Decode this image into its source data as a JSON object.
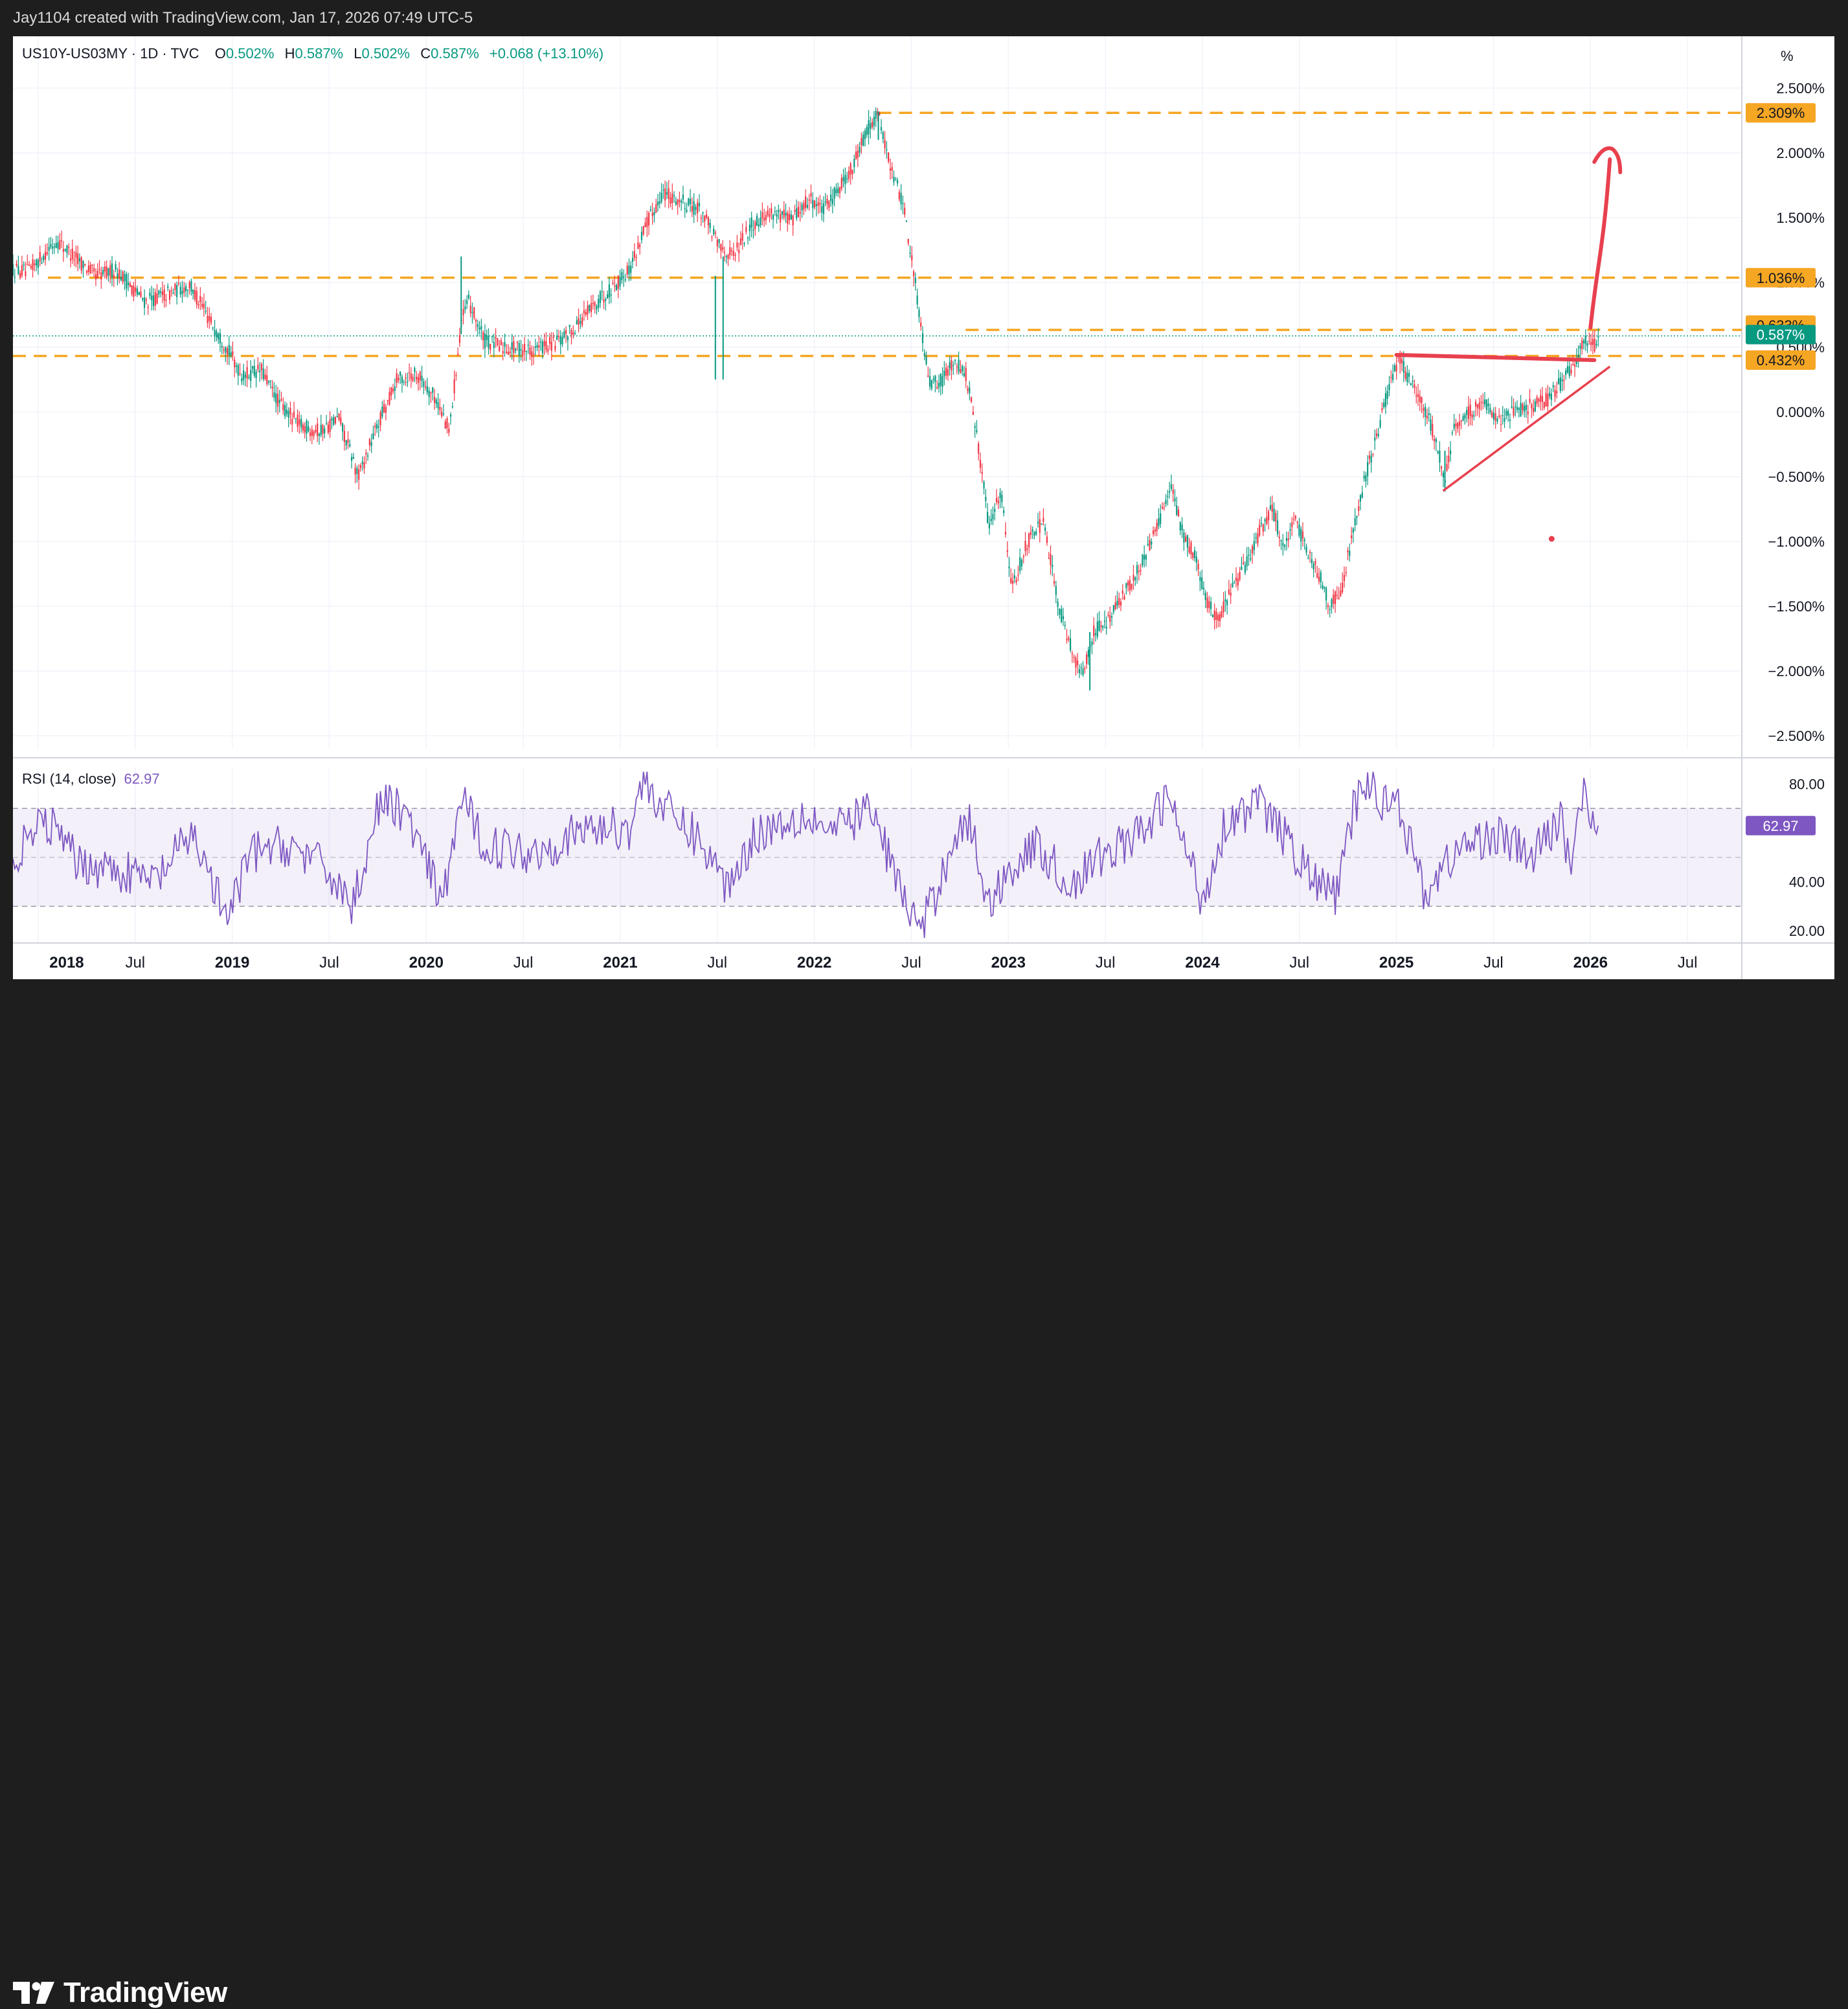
{
  "credit": "Jay1104 created with TradingView.com, Jan 17, 2026 07:49 UTC-5",
  "legend": {
    "symbol": "US10Y-US03MY · 1D · TVC",
    "o_label": "O",
    "o_value": "0.502%",
    "h_label": "H",
    "h_value": "0.587%",
    "l_label": "L",
    "l_value": "0.502%",
    "c_label": "C",
    "c_value": "0.587%",
    "change": "+0.068 (+13.10%)"
  },
  "unit_label": "%",
  "rsi_legend": {
    "label": "RSI (14, close)",
    "value": "62.97"
  },
  "brand": "TradingView",
  "colors": {
    "up": "#089981",
    "down": "#f23645",
    "level": "#f5a623",
    "rsi": "#7e57c2",
    "annotation": "#e8404e",
    "grid": "#f0f3fa"
  },
  "chart_data": [
    {
      "type": "candlestick",
      "symbol": "US10Y-US03MY",
      "unit": "%",
      "ylim": [
        -2.6,
        2.6
      ],
      "y_ticks": [
        "2.500%",
        "2.000%",
        "1.500%",
        "1.000%",
        "0.500%",
        "0.000%",
        "−0.500%",
        "−1.000%",
        "−1.500%",
        "−2.000%",
        "−2.500%"
      ],
      "y_tick_values": [
        2.5,
        2.0,
        1.5,
        1.0,
        0.5,
        0.0,
        -0.5,
        -1.0,
        -1.5,
        -2.0,
        -2.5
      ],
      "x_ticks": [
        "2018",
        "Jul",
        "2019",
        "Jul",
        "2020",
        "Jul",
        "2021",
        "Jul",
        "2022",
        "Jul",
        "2023",
        "Jul",
        "2024",
        "Jul",
        "2025",
        "Jul",
        "2026",
        "Jul"
      ],
      "x_tick_dates": [
        2018.0,
        2018.5,
        2019.0,
        2019.5,
        2020.0,
        2020.5,
        2021.0,
        2021.5,
        2022.0,
        2022.5,
        2023.0,
        2023.5,
        2024.0,
        2024.5,
        2025.0,
        2025.5,
        2026.0,
        2026.5
      ],
      "x_range": [
        2017.87,
        2026.78
      ],
      "price_path": [
        [
          2017.87,
          1.1
        ],
        [
          2017.95,
          1.08
        ],
        [
          2018.05,
          1.25
        ],
        [
          2018.1,
          1.32
        ],
        [
          2018.2,
          1.18
        ],
        [
          2018.3,
          1.05
        ],
        [
          2018.4,
          1.1
        ],
        [
          2018.55,
          0.85
        ],
        [
          2018.65,
          0.9
        ],
        [
          2018.78,
          0.98
        ],
        [
          2018.88,
          0.72
        ],
        [
          2018.97,
          0.5
        ],
        [
          2019.05,
          0.28
        ],
        [
          2019.15,
          0.32
        ],
        [
          2019.25,
          0.05
        ],
        [
          2019.35,
          -0.1
        ],
        [
          2019.45,
          -0.15
        ],
        [
          2019.55,
          -0.05
        ],
        [
          2019.65,
          -0.5
        ],
        [
          2019.75,
          -0.1
        ],
        [
          2019.85,
          0.25
        ],
        [
          2019.95,
          0.3
        ],
        [
          2020.05,
          0.1
        ],
        [
          2020.12,
          -0.15
        ],
        [
          2020.18,
          0.7
        ],
        [
          2020.22,
          0.85
        ],
        [
          2020.3,
          0.55
        ],
        [
          2020.4,
          0.5
        ],
        [
          2020.55,
          0.48
        ],
        [
          2020.7,
          0.55
        ],
        [
          2020.85,
          0.8
        ],
        [
          2020.95,
          0.95
        ],
        [
          2021.05,
          1.1
        ],
        [
          2021.12,
          1.4
        ],
        [
          2021.22,
          1.7
        ],
        [
          2021.32,
          1.62
        ],
        [
          2021.42,
          1.55
        ],
        [
          2021.5,
          1.3
        ],
        [
          2021.58,
          1.2
        ],
        [
          2021.68,
          1.45
        ],
        [
          2021.78,
          1.55
        ],
        [
          2021.88,
          1.48
        ],
        [
          2021.98,
          1.65
        ],
        [
          2022.05,
          1.55
        ],
        [
          2022.12,
          1.72
        ],
        [
          2022.2,
          1.9
        ],
        [
          2022.28,
          2.2
        ],
        [
          2022.33,
          2.3
        ],
        [
          2022.4,
          1.85
        ],
        [
          2022.46,
          1.6
        ],
        [
          2022.52,
          1.0
        ],
        [
          2022.56,
          0.55
        ],
        [
          2022.6,
          0.2
        ],
        [
          2022.66,
          0.25
        ],
        [
          2022.72,
          0.4
        ],
        [
          2022.78,
          0.3
        ],
        [
          2022.84,
          -0.2
        ],
        [
          2022.9,
          -0.9
        ],
        [
          2022.96,
          -0.6
        ],
        [
          2023.02,
          -1.35
        ],
        [
          2023.1,
          -1.0
        ],
        [
          2023.18,
          -0.85
        ],
        [
          2023.26,
          -1.5
        ],
        [
          2023.32,
          -1.8
        ],
        [
          2023.38,
          -2.05
        ],
        [
          2023.44,
          -1.7
        ],
        [
          2023.52,
          -1.6
        ],
        [
          2023.6,
          -1.4
        ],
        [
          2023.68,
          -1.2
        ],
        [
          2023.76,
          -0.9
        ],
        [
          2023.84,
          -0.6
        ],
        [
          2023.9,
          -0.95
        ],
        [
          2023.96,
          -1.1
        ],
        [
          2024.02,
          -1.45
        ],
        [
          2024.08,
          -1.6
        ],
        [
          2024.14,
          -1.4
        ],
        [
          2024.22,
          -1.2
        ],
        [
          2024.3,
          -0.9
        ],
        [
          2024.36,
          -0.75
        ],
        [
          2024.42,
          -1.05
        ],
        [
          2024.48,
          -0.85
        ],
        [
          2024.54,
          -1.05
        ],
        [
          2024.6,
          -1.25
        ],
        [
          2024.66,
          -1.5
        ],
        [
          2024.72,
          -1.35
        ],
        [
          2024.78,
          -0.9
        ],
        [
          2024.84,
          -0.5
        ],
        [
          2024.9,
          -0.2
        ],
        [
          2024.96,
          0.2
        ],
        [
          2025.02,
          0.4
        ],
        [
          2025.08,
          0.2
        ],
        [
          2025.14,
          0.05
        ],
        [
          2025.2,
          -0.2
        ],
        [
          2025.25,
          -0.5
        ],
        [
          2025.3,
          -0.1
        ],
        [
          2025.38,
          0.0
        ],
        [
          2025.46,
          0.05
        ],
        [
          2025.54,
          -0.05
        ],
        [
          2025.62,
          0.0
        ],
        [
          2025.7,
          0.05
        ],
        [
          2025.78,
          0.1
        ],
        [
          2025.86,
          0.25
        ],
        [
          2025.92,
          0.4
        ],
        [
          2025.97,
          0.55
        ],
        [
          2026.02,
          0.52
        ],
        [
          2026.04,
          0.587
        ]
      ],
      "extreme_wicks": [
        {
          "date": 2020.18,
          "high": 1.2,
          "low": 0.6
        },
        {
          "date": 2021.49,
          "high": 1.05,
          "low": 0.25
        },
        {
          "date": 2021.53,
          "high": 1.2,
          "low": 0.25
        },
        {
          "date": 2022.33,
          "high": 2.32,
          "low": 2.1
        },
        {
          "date": 2023.42,
          "high": -1.7,
          "low": -2.15
        },
        {
          "date": 2025.25,
          "high": -0.3,
          "low": -0.6
        }
      ],
      "horizontal_levels": [
        {
          "value": 2.309,
          "label": "2.309%",
          "from": 2022.33
        },
        {
          "value": 1.036,
          "label": "1.036%",
          "from": 2018.05
        },
        {
          "value": 0.633,
          "label": "0.633%",
          "from": 2022.78
        },
        {
          "value": 0.432,
          "label": "0.432%",
          "from": 2017.87
        }
      ],
      "last_price": {
        "value": 0.587,
        "label": "0.587%"
      },
      "annotations": [
        {
          "kind": "resistance-line",
          "from": [
            2025.0,
            0.44
          ],
          "to": [
            2026.02,
            0.4
          ]
        },
        {
          "kind": "trend-line",
          "from": [
            2025.24,
            -0.61
          ],
          "to": [
            2026.1,
            0.35
          ]
        },
        {
          "kind": "forecast-arrow",
          "from": [
            2026.0,
            0.65
          ],
          "to": [
            2026.1,
            1.95
          ]
        },
        {
          "kind": "dot",
          "at": [
            2025.8,
            -0.98
          ]
        }
      ]
    },
    {
      "type": "line",
      "name": "RSI (14, close)",
      "last_value": 62.97,
      "last_label": "62.97",
      "ylim": [
        15,
        87
      ],
      "y_ticks": [
        "80.00",
        "40.00",
        "20.00"
      ],
      "y_tick_values": [
        80,
        40,
        20
      ],
      "bands": {
        "upper": 70,
        "middle": 50,
        "lower": 30
      },
      "keypoints": [
        [
          2017.87,
          50
        ],
        [
          2018.05,
          65
        ],
        [
          2018.2,
          48
        ],
        [
          2018.4,
          45
        ],
        [
          2018.6,
          40
        ],
        [
          2018.8,
          60
        ],
        [
          2018.97,
          24
        ],
        [
          2019.1,
          52
        ],
        [
          2019.3,
          55
        ],
        [
          2019.5,
          44
        ],
        [
          2019.62,
          30
        ],
        [
          2019.75,
          70
        ],
        [
          2019.85,
          72
        ],
        [
          2019.95,
          58
        ],
        [
          2020.08,
          30
        ],
        [
          2020.18,
          74
        ],
        [
          2020.3,
          55
        ],
        [
          2020.55,
          52
        ],
        [
          2020.85,
          62
        ],
        [
          2021.05,
          62
        ],
        [
          2021.12,
          82
        ],
        [
          2021.22,
          70
        ],
        [
          2021.4,
          58
        ],
        [
          2021.55,
          38
        ],
        [
          2021.7,
          60
        ],
        [
          2021.95,
          68
        ],
        [
          2022.1,
          60
        ],
        [
          2022.28,
          70
        ],
        [
          2022.35,
          58
        ],
        [
          2022.45,
          35
        ],
        [
          2022.55,
          20
        ],
        [
          2022.65,
          40
        ],
        [
          2022.72,
          60
        ],
        [
          2022.8,
          64
        ],
        [
          2022.9,
          30
        ],
        [
          2023.0,
          45
        ],
        [
          2023.15,
          55
        ],
        [
          2023.32,
          38
        ],
        [
          2023.5,
          52
        ],
        [
          2023.7,
          60
        ],
        [
          2023.82,
          75
        ],
        [
          2023.95,
          45
        ],
        [
          2024.0,
          32
        ],
        [
          2024.12,
          65
        ],
        [
          2024.3,
          72
        ],
        [
          2024.45,
          55
        ],
        [
          2024.6,
          38
        ],
        [
          2024.7,
          35
        ],
        [
          2024.78,
          70
        ],
        [
          2024.85,
          82
        ],
        [
          2024.92,
          72
        ],
        [
          2025.0,
          78
        ],
        [
          2025.05,
          60
        ],
        [
          2025.15,
          35
        ],
        [
          2025.3,
          52
        ],
        [
          2025.5,
          60
        ],
        [
          2025.7,
          50
        ],
        [
          2025.85,
          66
        ],
        [
          2025.9,
          45
        ],
        [
          2025.95,
          77
        ],
        [
          2026.0,
          70
        ],
        [
          2026.04,
          62.97
        ]
      ]
    }
  ]
}
